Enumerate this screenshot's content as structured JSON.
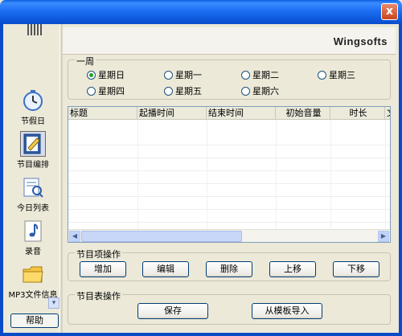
{
  "window": {
    "close_label": "x"
  },
  "sidebar": {
    "items": [
      {
        "label": "节假日",
        "icon": "clock-icon"
      },
      {
        "label": "节目编排",
        "icon": "edit-icon"
      },
      {
        "label": "今日列表",
        "icon": "list-search-icon"
      },
      {
        "label": "录音",
        "icon": "music-note-icon"
      },
      {
        "label": "MP3文件信息",
        "icon": "folder-icon"
      }
    ],
    "help_label": "帮助"
  },
  "banner": {
    "brand": "Wingsofts"
  },
  "week": {
    "title": "一周",
    "days": [
      "星期日",
      "星期一",
      "星期二",
      "星期三",
      "星期四",
      "星期五",
      "星期六"
    ],
    "selected": "星期日"
  },
  "table": {
    "columns": [
      "标题",
      "起播时间",
      "结束时间",
      "初始音量",
      "时长",
      "文"
    ],
    "rows": []
  },
  "item_ops": {
    "title": "节目项操作",
    "buttons": [
      "增加",
      "编辑",
      "删除",
      "上移",
      "下移"
    ]
  },
  "table_ops": {
    "title": "节目表操作",
    "buttons": [
      "保存",
      "从模板导入"
    ]
  },
  "colors": {
    "titlebar": "#0A5FE0",
    "selected_radio": "#21A121"
  }
}
